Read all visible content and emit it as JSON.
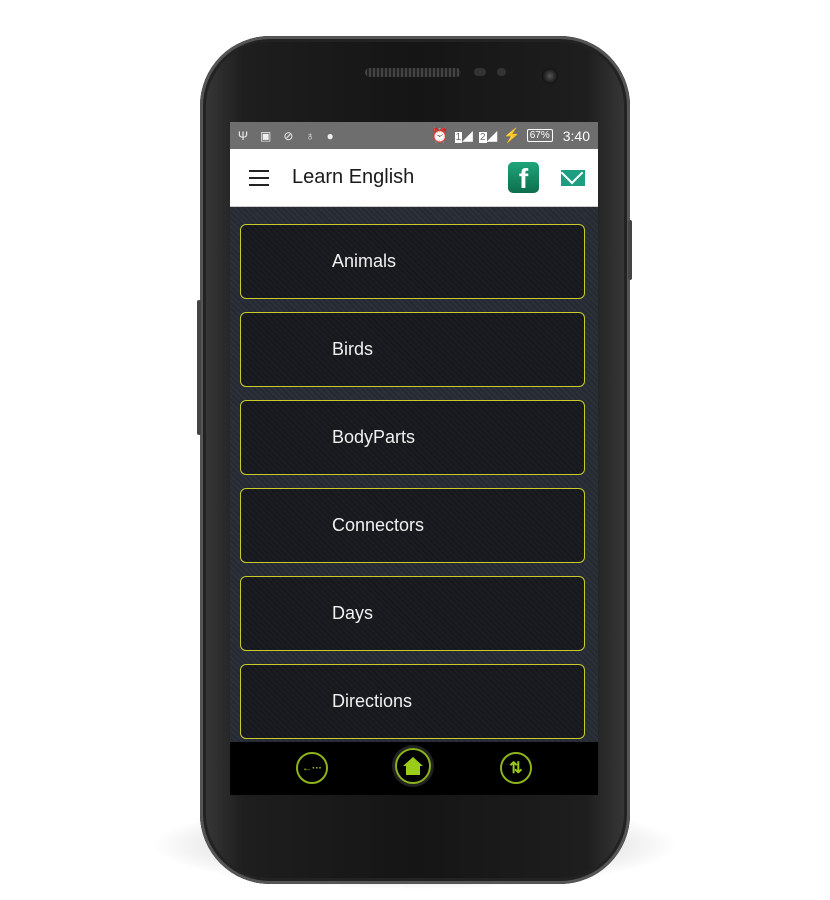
{
  "status_bar": {
    "icons": [
      "usb-icon",
      "image-icon",
      "blocked-icon",
      "bulb-icon",
      "android-icon",
      "alarm-icon",
      "sim1-signal-icon",
      "sim2-signal-icon",
      "charging-icon"
    ],
    "sim1": "1",
    "sim2": "2",
    "battery": "67%",
    "time": "3:40"
  },
  "header": {
    "title": "Learn English",
    "facebook_letter": "f"
  },
  "list": {
    "items": [
      {
        "label": "Animals"
      },
      {
        "label": "Birds"
      },
      {
        "label": "BodyParts"
      },
      {
        "label": "Connectors"
      },
      {
        "label": "Days"
      },
      {
        "label": "Directions"
      }
    ]
  },
  "bottom_nav": {
    "back_glyph": "←···",
    "home_icon": "home-icon",
    "sort_glyph": "⇅"
  },
  "colors": {
    "accent": "#c8cc2a",
    "nav_green": "#9ccc1a",
    "facebook": "#1a8a62",
    "mail": "#1d9e80",
    "status_bar": "#6e6e6e"
  }
}
